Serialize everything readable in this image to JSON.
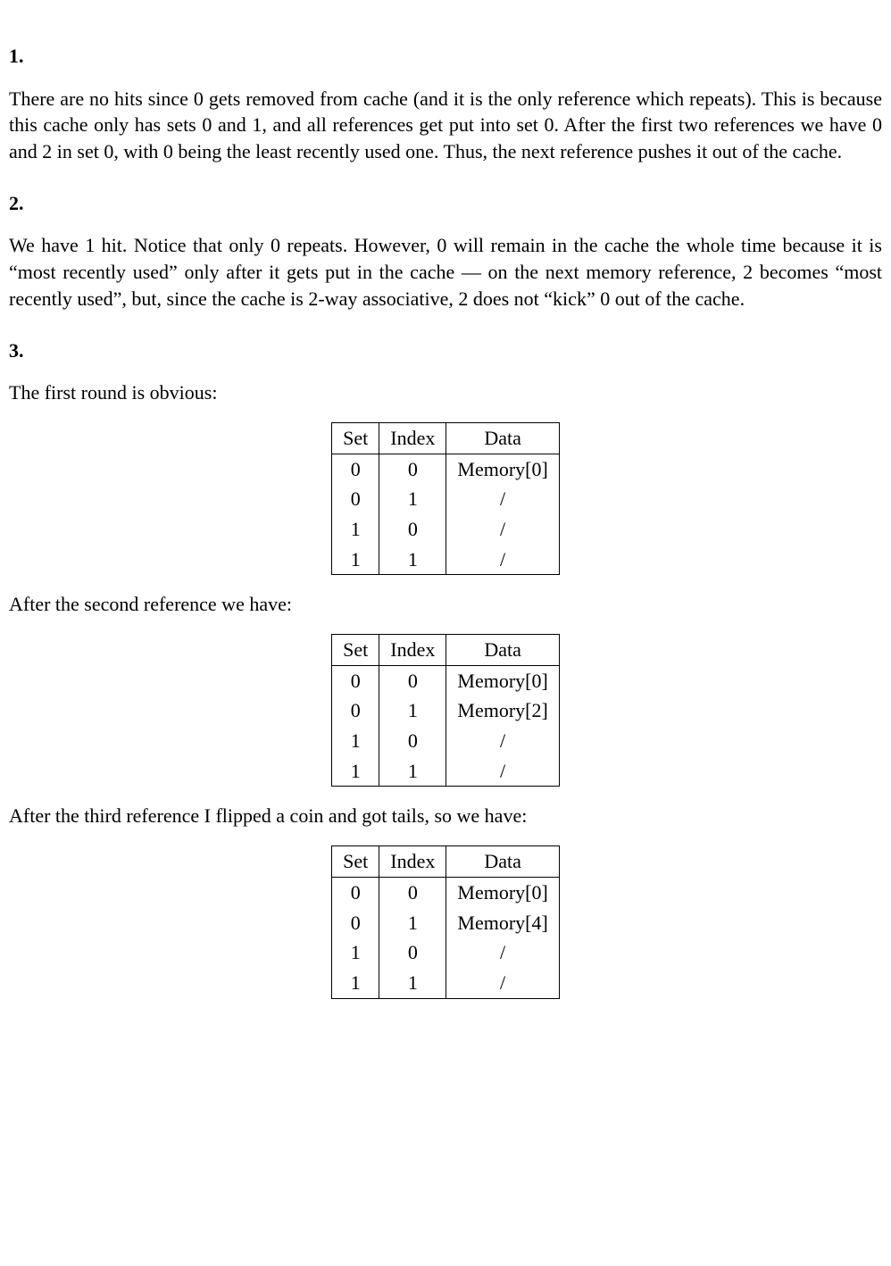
{
  "sections": {
    "s1": {
      "heading": "1.",
      "para": "There are no hits since 0 gets removed from cache (and it is the only reference which repeats). This is because this cache only has sets 0 and 1, and all references get put into set 0. After the first two references we have 0 and 2 in set 0, with 0 being the least recently used one. Thus, the next reference pushes it out of the cache."
    },
    "s2": {
      "heading": "2.",
      "para": "We have 1 hit. Notice that only 0 repeats. However, 0 will remain in the cache the whole time because it is “most recently used” only after it gets put in the cache — on the next memory reference, 2 becomes “most recently used”, but, since the cache is 2-way associative, 2 does not “kick” 0 out of the cache."
    },
    "s3": {
      "heading": "3.",
      "intro": "The first round is obvious:",
      "after_second": "After the second reference we have:",
      "after_third": "After the third reference I flipped a coin and got tails, so we have:"
    }
  },
  "table_headers": {
    "c0": "Set",
    "c1": "Index",
    "c2": "Data"
  },
  "table1": {
    "rows": [
      {
        "set": "0",
        "index": "0",
        "data": "Memory[0]"
      },
      {
        "set": "0",
        "index": "1",
        "data": "/"
      },
      {
        "set": "1",
        "index": "0",
        "data": "/"
      },
      {
        "set": "1",
        "index": "1",
        "data": "/"
      }
    ]
  },
  "table2": {
    "rows": [
      {
        "set": "0",
        "index": "0",
        "data": "Memory[0]"
      },
      {
        "set": "0",
        "index": "1",
        "data": "Memory[2]"
      },
      {
        "set": "1",
        "index": "0",
        "data": "/"
      },
      {
        "set": "1",
        "index": "1",
        "data": "/"
      }
    ]
  },
  "table3": {
    "rows": [
      {
        "set": "0",
        "index": "0",
        "data": "Memory[0]"
      },
      {
        "set": "0",
        "index": "1",
        "data": "Memory[4]"
      },
      {
        "set": "1",
        "index": "0",
        "data": "/"
      },
      {
        "set": "1",
        "index": "1",
        "data": "/"
      }
    ]
  }
}
